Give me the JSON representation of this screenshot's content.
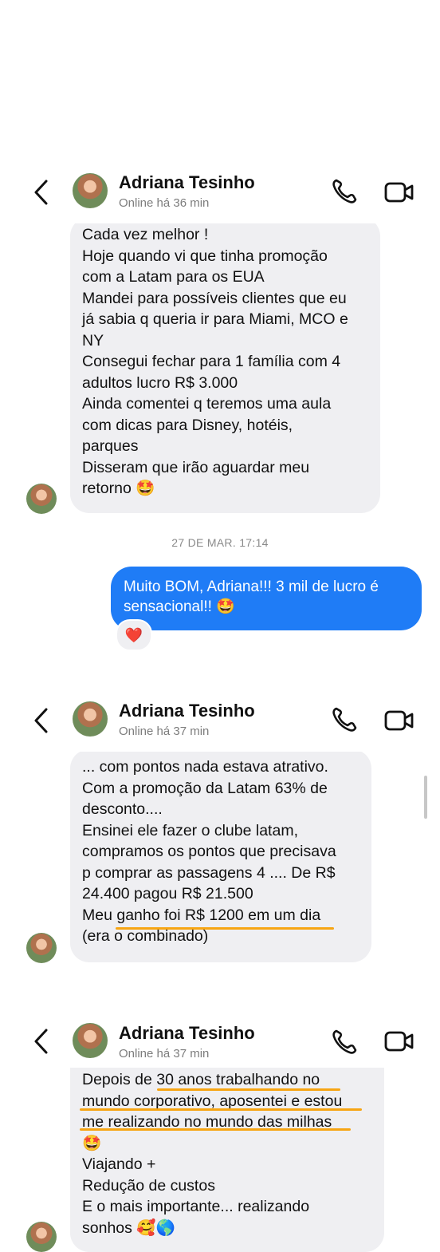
{
  "contact": {
    "name": "Adriana Tesinho",
    "status_1": "Online há 36 min",
    "status_2": "Online há 37 min",
    "status_3": "Online há 37 min"
  },
  "chat1": {
    "incoming_lines": [
      "Cada vez melhor !",
      "Hoje quando  vi que tinha promoção",
      "com a Latam para os EUA",
      "Mandei para possíveis clientes que eu",
      "já sabia q queria ir para Miami, MCO e",
      "NY",
      "Consegui fechar para 1 família com 4",
      "adultos lucro R$ 3.000",
      "Ainda comentei q teremos uma aula",
      "com dicas para Disney, hotéis,",
      "parques",
      "Disseram que irão aguardar meu",
      "retorno 🤩"
    ],
    "timestamp": "27 DE MAR. 17:14",
    "outgoing_lines": [
      "Muito BOM, Adriana!!! 3 mil de lucro é",
      "sensacional!! 🤩"
    ],
    "reaction": "❤️"
  },
  "chat2": {
    "incoming_lines": [
      "... com pontos nada estava atrativo.",
      "Com a promoção da Latam 63% de",
      "desconto....",
      "Ensinei ele fazer o clube latam,",
      "compramos os pontos que precisava",
      "p comprar as passagens 4 .... De R$",
      "24.400 pagou R$ 21.500",
      "Meu ganho foi R$ 1200 em um dia",
      "(era o combinado)"
    ]
  },
  "chat3": {
    "incoming_lines": [
      "Depois de 30 anos trabalhando no",
      "mundo corporativo, aposentei e estou",
      "me realizando no mundo das milhas",
      "🤩",
      "Viajando +",
      "Redução de custos",
      "E o mais importante... realizando",
      "sonhos 🥰🌎"
    ]
  },
  "colors": {
    "outgoing_bubble": "#1f7cf6",
    "incoming_bubble": "#efeff2",
    "highlight": "#f7a513"
  },
  "icons": [
    "back-chevron-icon",
    "phone-icon",
    "video-camera-icon",
    "heart-icon"
  ]
}
